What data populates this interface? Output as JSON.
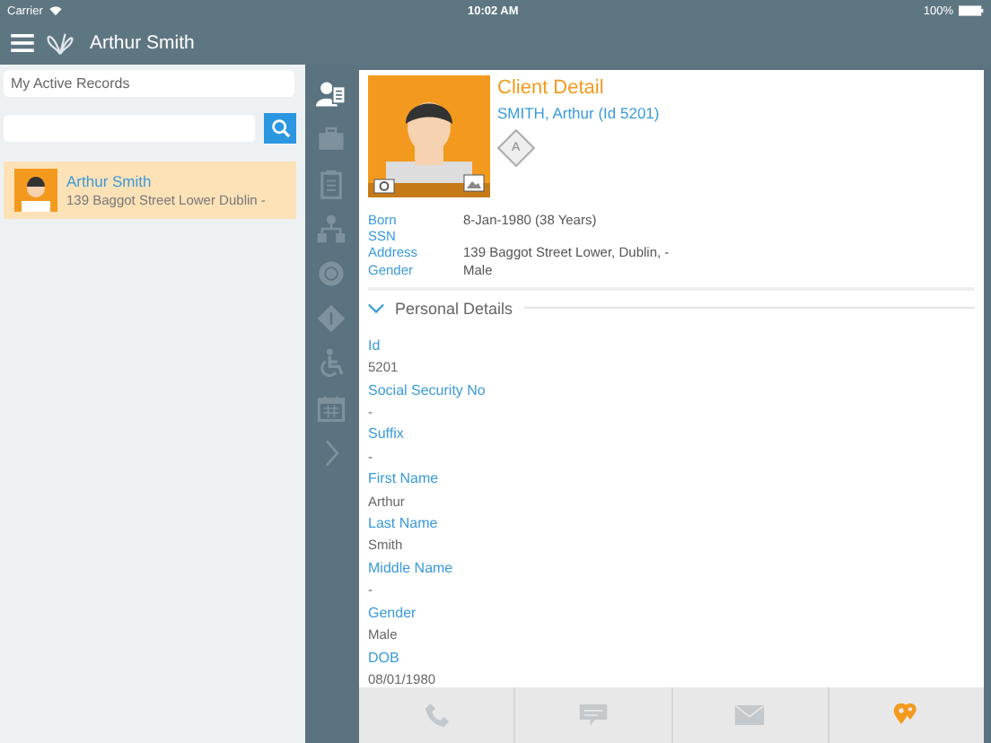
{
  "status_bar": {
    "carrier": "Carrier",
    "time": "10:02 AM",
    "battery": "100%"
  },
  "header": {
    "title": "Arthur Smith"
  },
  "sidebar": {
    "filter": "My Active Records",
    "records": [
      {
        "name": "Arthur Smith",
        "address": "139 Baggot Street Lower Dublin -",
        "selected": true
      }
    ]
  },
  "rail": [
    {
      "kind": "person-list",
      "selected": true
    },
    {
      "kind": "briefcase",
      "selected": false
    },
    {
      "kind": "clipboard",
      "selected": false
    },
    {
      "kind": "org-chart",
      "selected": false
    },
    {
      "kind": "badge",
      "selected": false
    },
    {
      "kind": "diamond",
      "selected": false
    },
    {
      "kind": "wheelchair",
      "selected": false
    },
    {
      "kind": "calendar",
      "selected": false
    },
    {
      "kind": "chevron",
      "selected": false
    }
  ],
  "client": {
    "title": "Client Detail",
    "subtitle": "SMITH, Arthur (Id 5201)",
    "badge": "A",
    "summary": [
      {
        "label": "Born",
        "value": "8-Jan-1980 (38 Years)"
      },
      {
        "label": "SSN"
      },
      {
        "label": "Address",
        "value": "139 Baggot Street Lower, Dublin, -"
      },
      {
        "label": "Gender",
        "value": "Male"
      }
    ]
  },
  "section": {
    "title": "Personal Details",
    "expanded": true,
    "fields": [
      {
        "label": "Id",
        "value": "5201"
      },
      {
        "label": "Social Security No",
        "value": "-"
      },
      {
        "label": "Suffix",
        "value": "-"
      },
      {
        "label": "First Name",
        "value": "Arthur"
      },
      {
        "label": "Last Name",
        "value": "Smith"
      },
      {
        "label": "Middle Name",
        "value": "-"
      },
      {
        "label": "Gender",
        "value": "Male"
      },
      {
        "label": "DOB",
        "value": "08/01/1980"
      }
    ]
  },
  "actions": [
    {
      "kind": "phone",
      "active": false
    },
    {
      "kind": "sms",
      "active": false
    },
    {
      "kind": "mail",
      "active": false
    },
    {
      "kind": "map-pins",
      "active": true
    }
  ]
}
